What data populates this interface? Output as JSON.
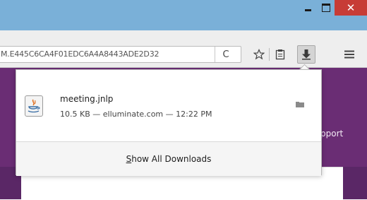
{
  "window": {
    "minimize_icon": "minimize-icon",
    "maximize_icon": "maximize-icon",
    "close_glyph": "✕"
  },
  "toolbar": {
    "url": "M.E445C6CA4F01EDC6A4A8443ADE2D32",
    "reload_glyph": "C"
  },
  "page": {
    "partial_link": "pport"
  },
  "downloads": {
    "items": [
      {
        "name": "meeting.jnlp",
        "meta": "10.5 KB — elluminate.com — 12:22 PM",
        "icon": "java-file-icon"
      }
    ],
    "show_all_label": "Show All Downloads",
    "show_all_access_key": "S"
  },
  "colors": {
    "titlebar": "#7ab0d8",
    "close": "#c73c36",
    "page_purple": "#6a2d74"
  }
}
